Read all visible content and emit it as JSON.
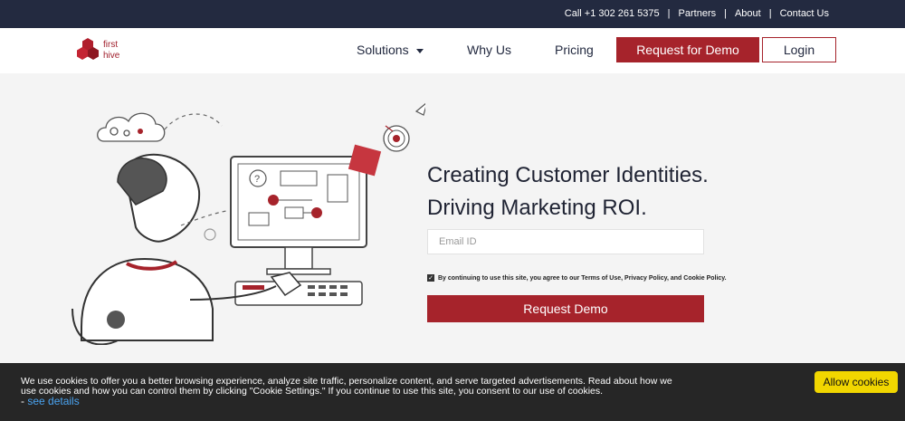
{
  "topbar": {
    "call": "Call +1 302 261 5375",
    "partners": "Partners",
    "about": "About",
    "contact": "Contact Us"
  },
  "logo": {
    "line1": "first",
    "line2": "hive"
  },
  "nav": {
    "solutions": "Solutions",
    "why_us": "Why Us",
    "pricing": "Pricing",
    "request_demo": "Request for Demo",
    "login": "Login"
  },
  "hero": {
    "headline_1": "Creating Customer Identities.",
    "headline_2": "Driving Marketing ROI.",
    "email_placeholder": "Email ID",
    "consent_prefix": "By continuing to use this site, you agree to our ",
    "terms": "Terms of Use",
    "consent_mid": ", ",
    "privacy": "Privacy Policy",
    "consent_and": ", and ",
    "cookie_policy": "Cookie Policy",
    "consent_end": ".",
    "request_button": "Request Demo"
  },
  "cookie": {
    "text": "We use cookies to offer you a better browsing experience, analyze site traffic, personalize content, and serve targeted advertisements. Read about how we use cookies and how you can control them by clicking \"Cookie Settings.\" If you continue to use this site, you consent to our use of cookies.",
    "dash": "- ",
    "see_details": "see details",
    "allow": "Allow cookies"
  },
  "colors": {
    "brand_red": "#a6232b",
    "navy": "#232a40",
    "cookie_button": "#f1d600",
    "link_blue": "#4aa3f0"
  },
  "icons": [
    "logo-hexagon-icon",
    "caret-down-icon",
    "checkbox-checked-icon",
    "cloud-social-icon",
    "rocket-icon",
    "target-icon"
  ]
}
